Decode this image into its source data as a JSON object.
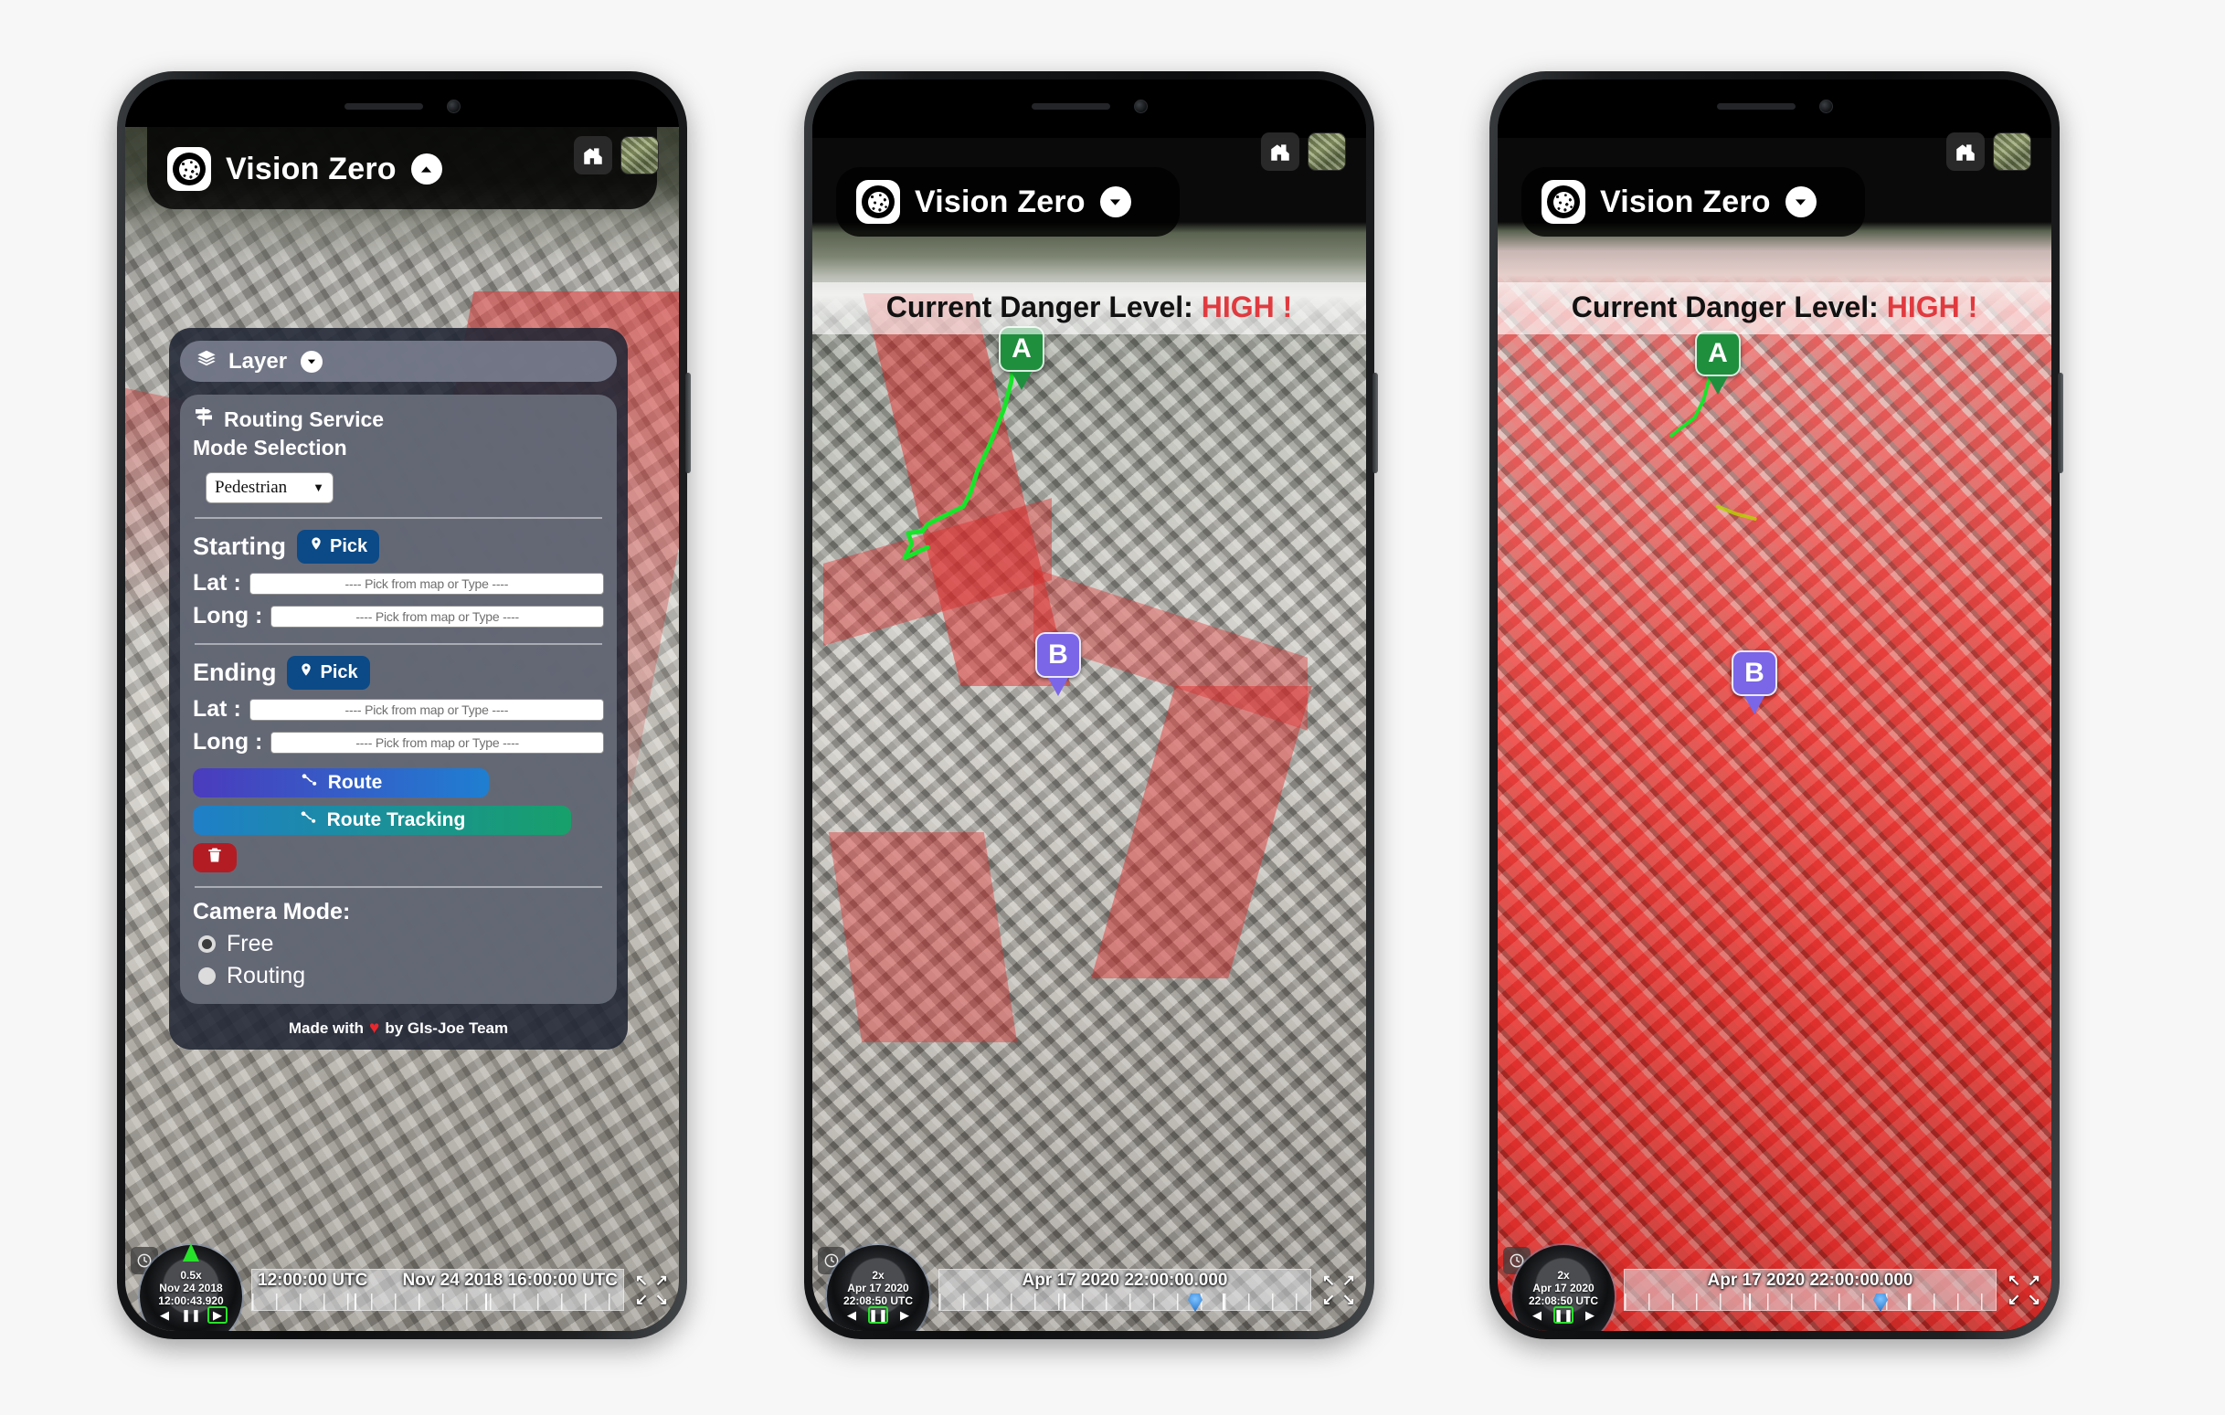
{
  "app": {
    "title": "Vision Zero",
    "logo_icon": "dotted-circle-logo"
  },
  "map_buttons": {
    "home_icon": "home-icon",
    "basemap_icon": "satellite-basemap-icon"
  },
  "phone1": {
    "chevron_icon": "chevron-up-icon",
    "panel": {
      "layer": {
        "label": "Layer",
        "icon": "layers-icon",
        "chevron": "chevron-down-icon"
      },
      "routing": {
        "title": "Routing Service",
        "icon": "signpost-icon",
        "collapse_icon": "chevron-up-icon",
        "mode_label": "Mode Selection",
        "mode_selected": "Pedestrian",
        "mode_options": [
          "Pedestrian"
        ],
        "caret_icon": "caret-down-icon"
      },
      "starting": {
        "label": "Starting",
        "pick_label": "Pick",
        "pin_icon": "map-pin-icon",
        "lat_label": "Lat :",
        "long_label": "Long :",
        "lat_value": "",
        "long_value": "",
        "placeholder": "---- Pick from map or Type ----"
      },
      "ending": {
        "label": "Ending",
        "pick_label": "Pick",
        "pin_icon": "map-pin-icon",
        "lat_label": "Lat :",
        "long_label": "Long :",
        "lat_value": "",
        "long_value": "",
        "placeholder": "---- Pick from map or Type ----"
      },
      "actions": {
        "route_label": "Route",
        "route_icon": "route-icon",
        "tracking_label": "Route Tracking",
        "tracking_icon": "route-icon",
        "delete_icon": "trash-icon"
      },
      "camera": {
        "title": "Camera Mode:",
        "options": [
          {
            "label": "Free",
            "selected": true
          },
          {
            "label": "Routing",
            "selected": false
          }
        ]
      },
      "footer": {
        "prefix": "Made with",
        "heart_icon": "heart-icon",
        "suffix": "by GIs-Joe Team"
      }
    },
    "timeline": {
      "clock_icon": "clock-icon",
      "speed": "0.5x",
      "date": "Nov 24 2018",
      "time": "12:00:43.920",
      "prev_icon": "step-back-icon",
      "pause_icon": "pause-icon",
      "play_icon": "play-icon",
      "play_active": true,
      "range_start": "12:00:00 UTC",
      "range_end": "Nov 24 2018 16:00:00 UTC",
      "fullscreen_icon": "fullscreen-icon"
    }
  },
  "phone2": {
    "chevron_icon": "chevron-down-icon",
    "danger": {
      "prefix": "Current Danger Level",
      "separator": ":",
      "level": "HIGH !"
    },
    "markers": [
      {
        "label": "A",
        "color": "#1f8f3e"
      },
      {
        "label": "B",
        "color": "#7b66e8"
      }
    ],
    "route_color": "#18e52a",
    "timeline": {
      "clock_icon": "clock-icon",
      "speed": "2x",
      "date": "Apr 17 2020",
      "time": "22:08:50 UTC",
      "prev_icon": "step-back-icon",
      "pause_icon": "pause-icon",
      "play_icon": "play-icon",
      "pause_active": true,
      "range_label": "Apr 17 2020 22:00:00.000",
      "fullscreen_icon": "fullscreen-icon"
    }
  },
  "phone3": {
    "chevron_icon": "chevron-down-icon",
    "danger": {
      "prefix": "Current Danger Level",
      "separator": ":",
      "level": "HIGH !"
    },
    "markers": [
      {
        "label": "A",
        "color": "#1f8f3e"
      },
      {
        "label": "B",
        "color": "#7b66e8"
      }
    ],
    "timeline": {
      "clock_icon": "clock-icon",
      "speed": "2x",
      "date": "Apr 17 2020",
      "time": "22:08:50 UTC",
      "prev_icon": "step-back-icon",
      "pause_icon": "pause-icon",
      "play_icon": "play-icon",
      "pause_active": true,
      "range_label": "Apr 17 2020 22:00:00.000",
      "fullscreen_icon": "fullscreen-icon"
    }
  }
}
